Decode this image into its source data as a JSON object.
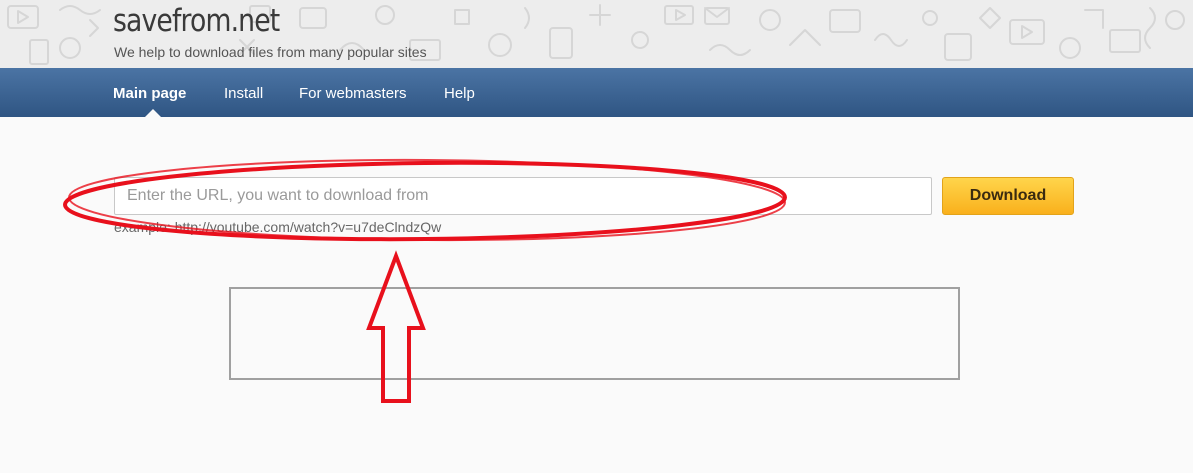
{
  "header": {
    "logo": "savefrom.net",
    "tagline": "We help to download files from many popular sites"
  },
  "nav": {
    "items": [
      {
        "label": "Main page",
        "active": true
      },
      {
        "label": "Install"
      },
      {
        "label": "For webmasters"
      },
      {
        "label": "Help"
      }
    ]
  },
  "form": {
    "url_placeholder": "Enter the URL, you want to download from",
    "url_value": "",
    "download_label": "Download",
    "example": "example: http://youtube.com/watch?v=u7deClndzQw"
  },
  "annotation": {
    "color": "#e8101c",
    "shapes": [
      "ellipse",
      "up-arrow"
    ]
  },
  "colors": {
    "nav_bar": "#3d6595",
    "button": "#fbbf2c",
    "page_bg": "#fafafa"
  }
}
